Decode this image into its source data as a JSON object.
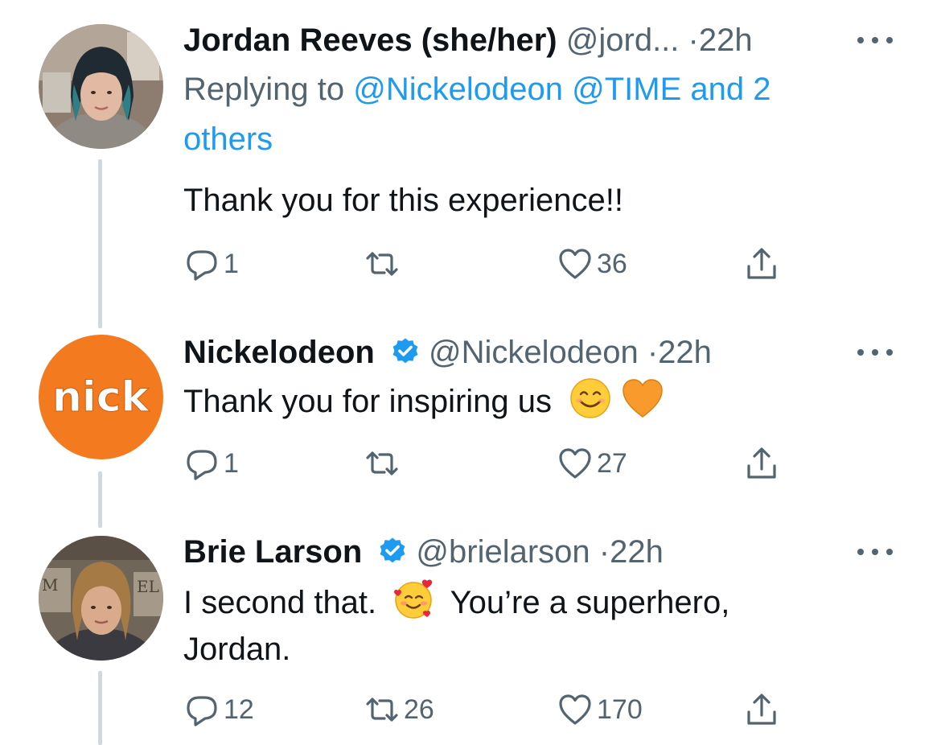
{
  "tweets": [
    {
      "name": "Jordan Reeves (she/her)",
      "handle": "@jord...",
      "separator": "·",
      "time": "22h",
      "replying_prefix": "Replying to",
      "replying_targets": "@Nickelodeon @TIME and 2",
      "replying_others": "others",
      "text": "Thank you for this experience!!",
      "reply_count": "1",
      "retweet_count": "",
      "like_count": "36"
    },
    {
      "name": "Nickelodeon",
      "handle": "@Nickelodeon",
      "separator": "·",
      "time": "22h",
      "text_part1": "Thank you for inspiring us",
      "avatar_logo": "nick",
      "reply_count": "1",
      "retweet_count": "",
      "like_count": "27"
    },
    {
      "name": "Brie Larson",
      "handle": "@brielarson",
      "separator": "·",
      "time": "22h",
      "text_part1": "I second that.",
      "text_part2": "You’re a superhero,",
      "text_part3": "Jordan.",
      "reply_count": "12",
      "retweet_count": "26",
      "like_count": "170"
    }
  ],
  "icons": {
    "reply": "speech-bubble-icon",
    "retweet": "retweet-arrows-icon",
    "like": "heart-icon",
    "share": "share-upload-icon",
    "verified": "verified-badge-icon",
    "more": "more-dots-icon"
  },
  "colors": {
    "link": "#1d9bf0",
    "secondary_text": "#536471",
    "nick_orange": "#f47a20",
    "verified": "#1d9bf0",
    "thread_line": "#cfd9de"
  }
}
